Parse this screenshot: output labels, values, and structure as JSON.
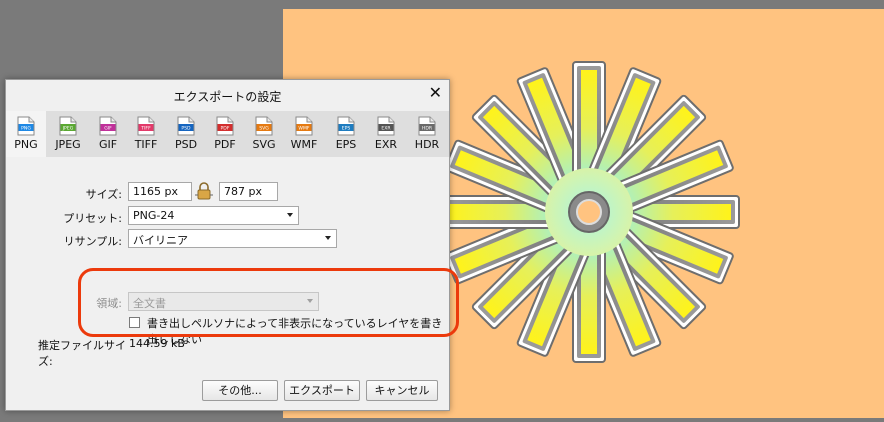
{
  "dialog": {
    "title": "エクスポートの設定",
    "close_symbol": "✕",
    "formats": [
      {
        "label": "PNG",
        "icon_text": "PNG",
        "color": "#1e88e5"
      },
      {
        "label": "JPEG",
        "icon_text": "JPEG",
        "color": "#5aa832"
      },
      {
        "label": "GIF",
        "icon_text": "GIF",
        "color": "#c0309a"
      },
      {
        "label": "TIFF",
        "icon_text": "TIFF",
        "color": "#e23a6a"
      },
      {
        "label": "PSD",
        "icon_text": "PSD",
        "color": "#1565c0"
      },
      {
        "label": "PDF",
        "icon_text": "PDF",
        "color": "#d32f2f"
      },
      {
        "label": "SVG",
        "icon_text": "SVG",
        "color": "#e57a12"
      },
      {
        "label": "WMF",
        "icon_text": "WMF",
        "color": "#e57a12"
      },
      {
        "label": "EPS",
        "icon_text": "EPS",
        "color": "#1e7cc0"
      },
      {
        "label": "EXR",
        "icon_text": "EXR",
        "color": "#555555"
      },
      {
        "label": "HDR",
        "icon_text": "HDR",
        "color": "#6a6a6a"
      }
    ],
    "active_format": "PNG",
    "size_label": "サイズ:",
    "width": "1165 px",
    "height": "787 px",
    "preset_label": "プリセット:",
    "preset_value": "PNG-24",
    "resample_label": "リサンプル:",
    "resample_value": "バイリニア",
    "area_label": "領域:",
    "area_value": "全文書",
    "checkbox_label": "書き出しペルソナによって非表示になっているレイヤを書き出ししない",
    "checkbox_checked": false,
    "filesize_label": "推定ファイルサイズ:",
    "filesize_value": "144.59 kB",
    "buttons": {
      "more": "その他...",
      "export": "エクスポート",
      "cancel": "キャンセル"
    }
  },
  "colors": {
    "canvas": "#ffc380",
    "highlight": "#ec3a0c",
    "workspace": "#7a7a7a"
  }
}
